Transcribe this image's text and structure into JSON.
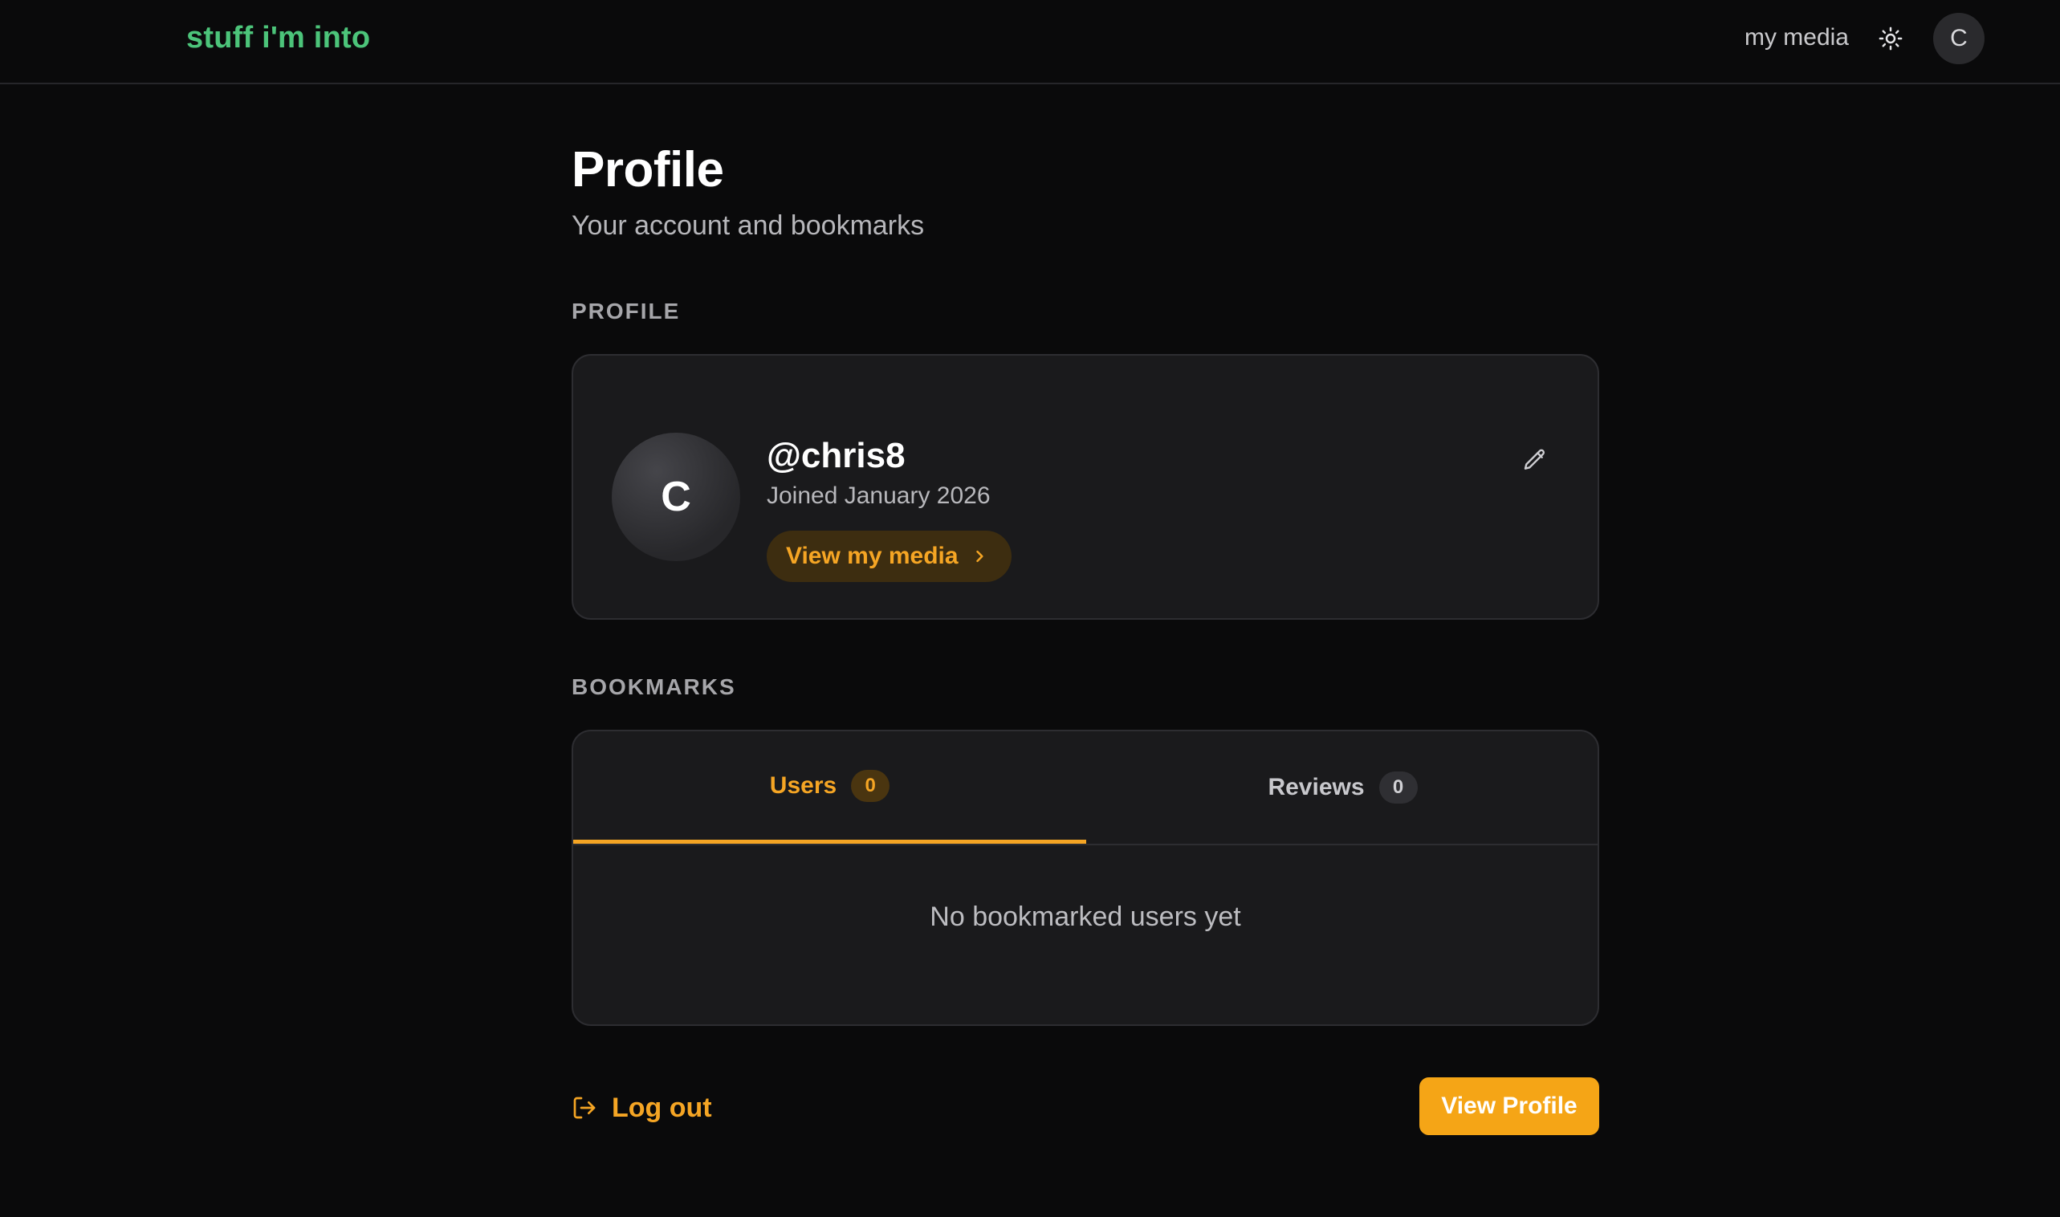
{
  "header": {
    "brand": "stuff i'm into",
    "nav_link": "my media",
    "theme_icon": "sun-icon",
    "avatar_initial": "C"
  },
  "page": {
    "title": "Profile",
    "subtitle": "Your account and bookmarks"
  },
  "profile_section": {
    "label": "PROFILE",
    "avatar_initial": "C",
    "username": "@chris8",
    "joined": "Joined January 2026",
    "media_button": "View my media",
    "media_button_icon": "chevron-right-icon",
    "edit_icon": "pencil-icon"
  },
  "bookmarks_section": {
    "label": "BOOKMARKS",
    "tabs": [
      {
        "label": "Users",
        "count": "0",
        "active": true
      },
      {
        "label": "Reviews",
        "count": "0",
        "active": false
      }
    ],
    "empty_message": "No bookmarked users yet"
  },
  "footer": {
    "logout_label": "Log out",
    "logout_icon": "log-out-icon",
    "view_profile_label": "View Profile"
  },
  "colors": {
    "background": "#0a0a0b",
    "card": "#1a1a1c",
    "brand": "#4cc47a",
    "accent": "#f5a524"
  }
}
